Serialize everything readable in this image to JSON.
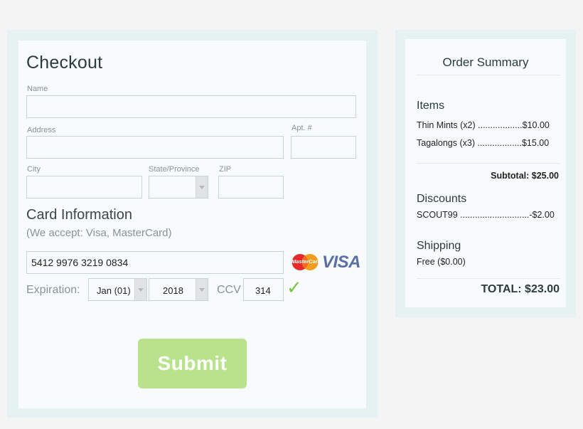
{
  "checkout": {
    "title": "Checkout",
    "name_label": "Name",
    "name_value": "",
    "address_label": "Address",
    "address_value": "",
    "apt_label": "Apt. #",
    "apt_value": "",
    "city_label": "City",
    "city_value": "",
    "state_label": "State/Province",
    "state_value": "",
    "zip_label": "ZIP",
    "zip_value": ""
  },
  "card": {
    "title": "Card Information",
    "accept_note": "(We accept: Visa, MasterCard)",
    "number": "5412 9976 3219 0834",
    "mastercard_logo_text": "MasterCard",
    "visa_logo_text": "VISA",
    "expiration_label": "Expiration:",
    "month": "Jan (01)",
    "year": "2018",
    "ccv_label": "CCV",
    "ccv": "314",
    "valid_mark": "✓"
  },
  "submit_label": "Submit",
  "summary": {
    "title": "Order Summary",
    "items_heading": "Items",
    "items": [
      {
        "line": "Thin Mints (x2) ..................$10.00"
      },
      {
        "line": "Tagalongs (x3) ..................$15.00"
      }
    ],
    "subtotal": "Subtotal: $25.00",
    "discounts_heading": "Discounts",
    "discount_line": "SCOUT99 ............................-$2.00",
    "shipping_heading": "Shipping",
    "shipping_line": "Free ($0.00)",
    "total": "TOTAL: $23.00"
  },
  "colors": {
    "submit": "#b8e38c",
    "valid_check": "#7cc442",
    "visa_blue": "#5a6fa6",
    "mastercard_red": "#e52a2a",
    "mastercard_orange": "#f39c1e"
  }
}
